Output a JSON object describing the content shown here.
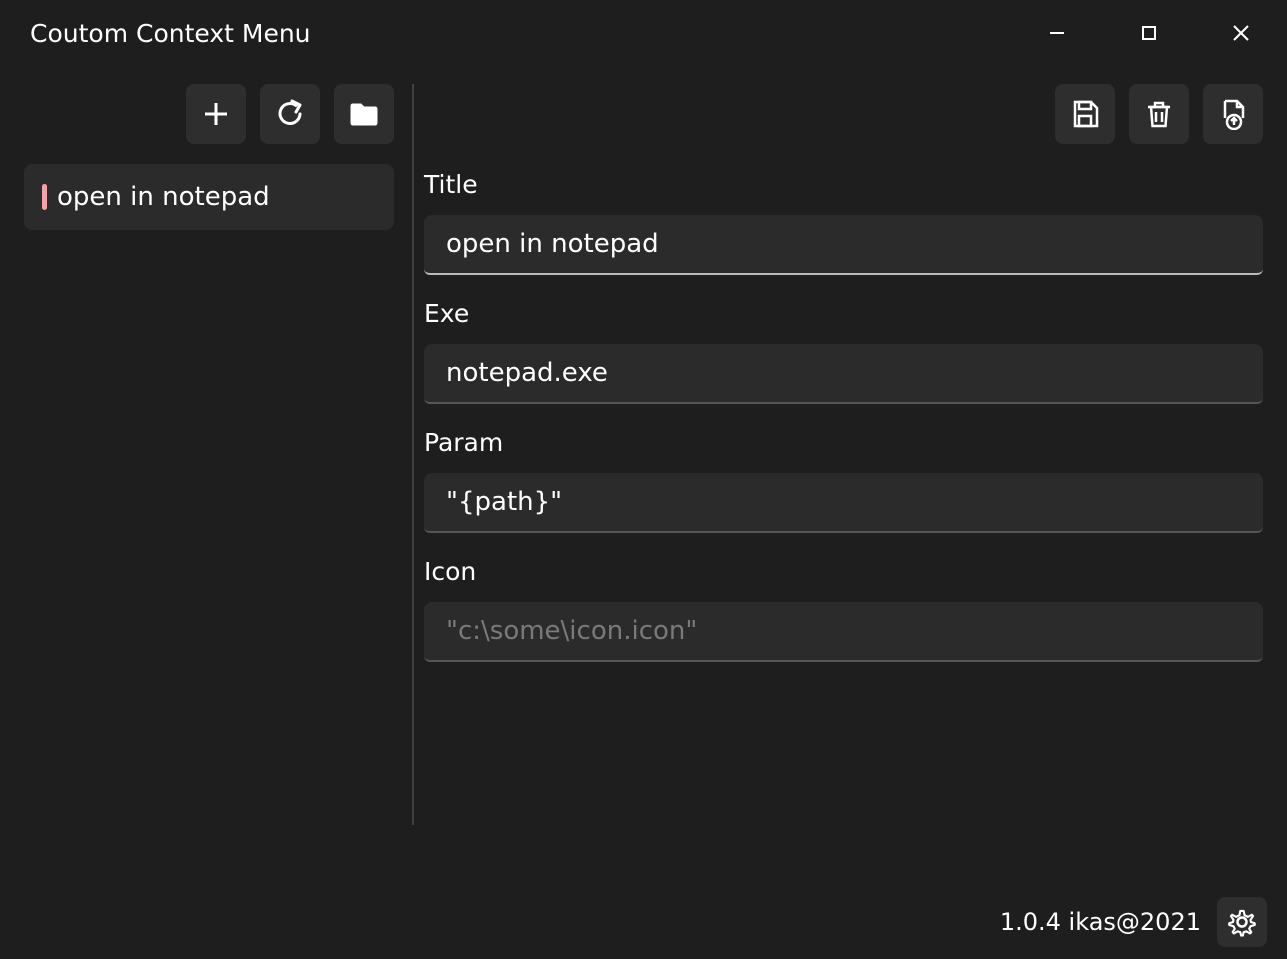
{
  "window": {
    "title": "Coutom Context Menu"
  },
  "sidebar": {
    "items": [
      {
        "label": "open in notepad"
      }
    ]
  },
  "form": {
    "title_label": "Title",
    "title_value": "open in notepad",
    "exe_label": "Exe",
    "exe_value": "notepad.exe",
    "param_label": "Param",
    "param_value": "\"{path}\"",
    "icon_label": "Icon",
    "icon_placeholder": "\"c:\\some\\icon.icon\""
  },
  "footer": {
    "text": "1.0.4 ikas@2021"
  }
}
